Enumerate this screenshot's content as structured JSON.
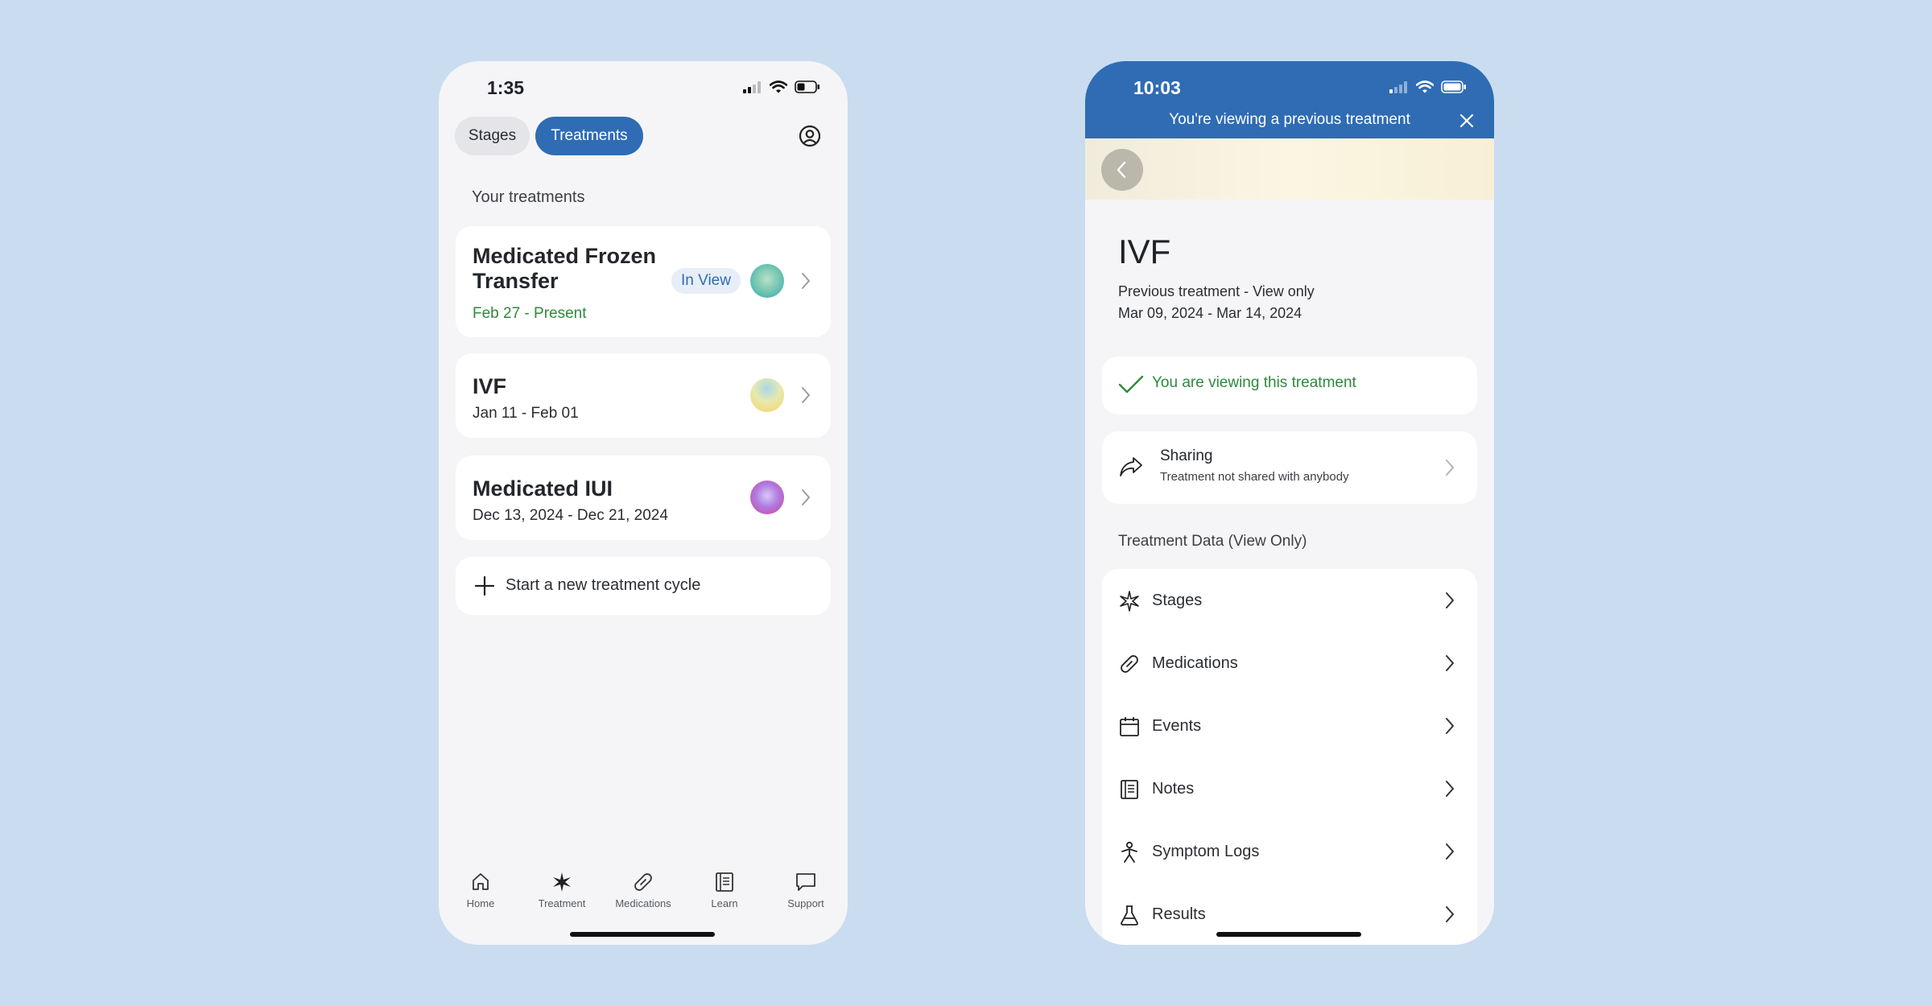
{
  "left_phone": {
    "status_time": "1:35",
    "tabs": [
      {
        "label": "Stages",
        "active": false
      },
      {
        "label": "Treatments",
        "active": true
      }
    ],
    "section_title": "Your treatments",
    "treatments": [
      {
        "name_line1": "Medicated Frozen",
        "name_line2": "Transfer",
        "dates": "Feb 27 - Present",
        "badge": "In View",
        "orb_colors": [
          "#b8e0c8",
          "#2aa8b0"
        ]
      },
      {
        "name_line1": "IVF",
        "name_line2": "",
        "dates": "Jan 11 - Feb 01",
        "badge": "",
        "orb_colors": [
          "#a8d8e8",
          "#f2d562"
        ]
      },
      {
        "name_line1": "Medicated IUI",
        "name_line2": "",
        "dates": "Dec 13, 2024 - Dec 21, 2024",
        "badge": "",
        "orb_colors": [
          "#d8c8f8",
          "#d0409a"
        ]
      }
    ],
    "new_cycle_label": "Start a new treatment cycle",
    "tabbar": [
      {
        "label": "Home",
        "icon": "home-icon"
      },
      {
        "label": "Treatment",
        "icon": "sparkle-icon"
      },
      {
        "label": "Medications",
        "icon": "pill-icon"
      },
      {
        "label": "Learn",
        "icon": "book-icon"
      },
      {
        "label": "Support",
        "icon": "chat-icon"
      }
    ]
  },
  "right_phone": {
    "status_time": "10:03",
    "banner_text": "You're viewing a previous treatment",
    "title": "IVF",
    "subtitle": "Previous treatment - View only",
    "date_range": "Mar 09, 2024 - Mar 14, 2024",
    "viewing_text": "You are viewing this treatment",
    "sharing": {
      "title": "Sharing",
      "subtitle": "Treatment not shared with anybody"
    },
    "section_title": "Treatment Data (View Only)",
    "data_items": [
      {
        "label": "Stages",
        "icon": "sparkle-icon"
      },
      {
        "label": "Medications",
        "icon": "pill-icon"
      },
      {
        "label": "Events",
        "icon": "calendar-icon"
      },
      {
        "label": "Notes",
        "icon": "notes-icon"
      },
      {
        "label": "Symptom Logs",
        "icon": "person-icon"
      },
      {
        "label": "Results",
        "icon": "flask-icon"
      }
    ]
  },
  "colors": {
    "background": "#cadcf0",
    "accent_blue": "#2f6cb3",
    "success_green": "#2d8a3c"
  }
}
